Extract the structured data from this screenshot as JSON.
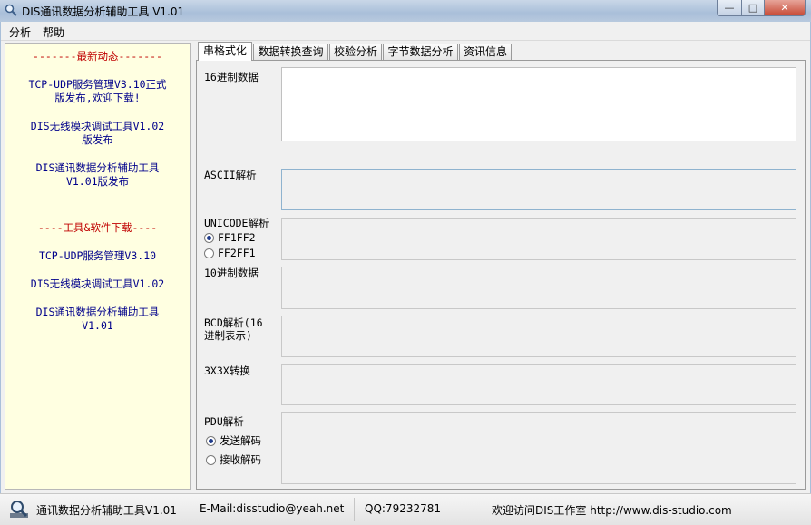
{
  "window": {
    "title": "DIS通讯数据分析辅助工具 V1.01",
    "min": "—",
    "max": "□",
    "close": "✕"
  },
  "menu": [
    "分析",
    "帮助"
  ],
  "left_panel": {
    "news_heading": "-------最新动态-------",
    "news": [
      [
        "TCP-UDP服务管理V3.10正式",
        "版发布,欢迎下载!"
      ],
      [
        "DIS无线模块调试工具V1.02",
        "版发布"
      ],
      [
        "DIS通讯数据分析辅助工具",
        "V1.01版发布"
      ]
    ],
    "download_heading": "----工具&软件下载----",
    "downloads": [
      [
        "TCP-UDP服务管理V3.10"
      ],
      [
        "DIS无线模块调试工具V1.02"
      ],
      [
        "DIS通讯数据分析辅助工具",
        "V1.01"
      ]
    ]
  },
  "tabs": [
    "串格式化",
    "数据转换查询",
    "校验分析",
    "字节数据分析",
    "资讯信息"
  ],
  "active_tab": 0,
  "fields": {
    "hex": "16进制数据",
    "ascii": "ASCII解析",
    "unicode": "UNICODE解析",
    "unicode_options": [
      "FF1FF2",
      "FF2FF1"
    ],
    "decimal": "10进制数据",
    "bcd": [
      "BCD解析(16",
      "进制表示)"
    ],
    "x3x3": "3X3X转换",
    "pdu": "PDU解析",
    "pdu_options": [
      "发送解码",
      "接收解码"
    ]
  },
  "status": {
    "app": "通讯数据分析辅助工具V1.01",
    "email": "E-Mail:disstudio@yeah.net",
    "qq": "QQ:79232781",
    "visit": "欢迎访问DIS工作室 http://www.dis-studio.com"
  },
  "colors": {
    "panel_bg": "#ffffe1",
    "heading": "#c00000",
    "link": "#00008b"
  }
}
